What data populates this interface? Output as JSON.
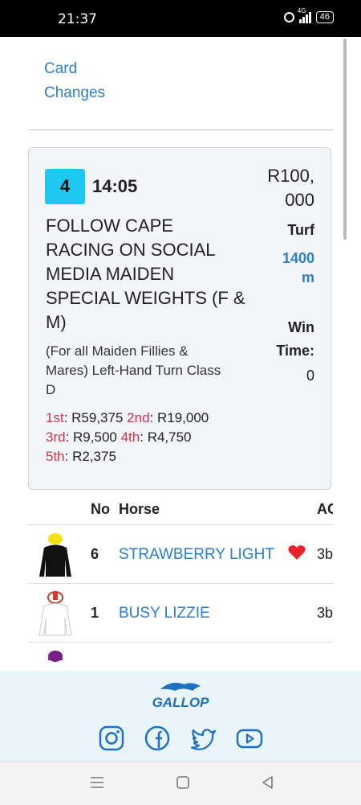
{
  "status_bar": {
    "time": "21:37",
    "network": "4G",
    "battery": "46"
  },
  "links": {
    "card_changes_line1": "Card",
    "card_changes_line2": "Changes"
  },
  "race": {
    "number": "4",
    "time": "14:05",
    "title": "FOLLOW CAPE RACING ON SOCIAL MEDIA MAIDEN SPECIAL WEIGHTS (F & M)",
    "description": "(For all Maiden Fillies & Mares) Left-Hand Turn Class D",
    "stake": "R100,000",
    "surface": "Turf",
    "distance": "1400 m",
    "win_time_label": "Win Time:",
    "win_time_value": "0",
    "prizes": [
      {
        "place": "1st",
        "amount": "R59,375"
      },
      {
        "place": "2nd",
        "amount": "R19,000"
      },
      {
        "place": "3rd",
        "amount": "R9,500"
      },
      {
        "place": "4th",
        "amount": "R4,750"
      },
      {
        "place": "5th",
        "amount": "R2,375"
      }
    ]
  },
  "table": {
    "headers": {
      "no": "No",
      "horse": "Horse",
      "age": "AG"
    },
    "rows": [
      {
        "no": "6",
        "horse": "STRAWBERRY LIGHT",
        "age": "3b",
        "favourite": true
      },
      {
        "no": "1",
        "horse": "BUSY LIZZIE",
        "age": "3b",
        "favourite": false
      }
    ]
  },
  "footer": {
    "logo_text": "GALLOP",
    "social": [
      "instagram-icon",
      "facebook-icon",
      "twitter-icon",
      "youtube-icon"
    ]
  },
  "colors": {
    "link": "#2a7ed4",
    "race_badge": "#1ec8f0",
    "prize_place": "#d1344a",
    "favourite": "#e8212b",
    "footer_bg": "#e9f4fb",
    "logo": "#1f6fc4"
  }
}
